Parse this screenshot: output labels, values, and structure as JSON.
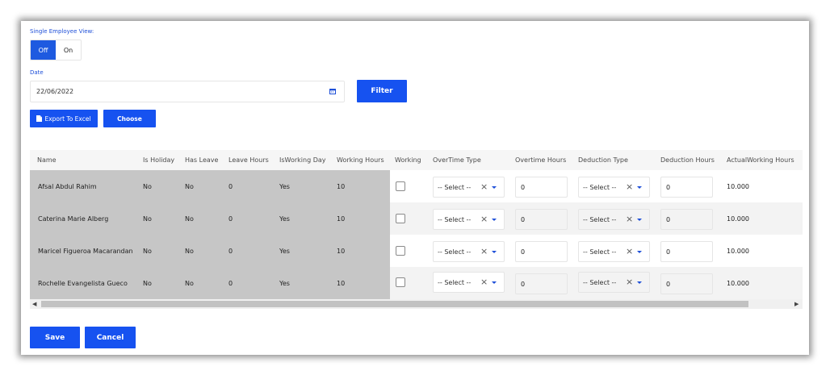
{
  "single_view": {
    "label": "Single Employee View:",
    "off": "Off",
    "on": "On"
  },
  "date": {
    "label": "Date",
    "value": "22/06/2022"
  },
  "buttons": {
    "filter": "Filter",
    "export": "Export To Excel",
    "choose": "Choose",
    "save": "Save",
    "cancel": "Cancel"
  },
  "headers": [
    "Name",
    "Is Holiday",
    "Has Leave",
    "Leave Hours",
    "IsWorking Day",
    "Working Hours",
    "Working",
    "OverTime Type",
    "Overtime Hours",
    "Deduction Type",
    "Deduction Hours",
    "ActualWorking Hours"
  ],
  "rows": [
    {
      "name": "Afsal Abdul Rahim",
      "holiday": "No",
      "leave": "No",
      "leave_hours": "0",
      "working_day": "Yes",
      "working_hours": "10",
      "ot_type": "-- Select --",
      "ot_hours": "0",
      "ded_type": "-- Select --",
      "ded_hours": "0",
      "actual": "10.000"
    },
    {
      "name": "Caterina Marie Alberg",
      "holiday": "No",
      "leave": "No",
      "leave_hours": "0",
      "working_day": "Yes",
      "working_hours": "10",
      "ot_type": "-- Select --",
      "ot_hours": "0",
      "ded_type": "-- Select --",
      "ded_hours": "0",
      "actual": "10.000"
    },
    {
      "name": "Maricel Figueroa Macarandan",
      "holiday": "No",
      "leave": "No",
      "leave_hours": "0",
      "working_day": "Yes",
      "working_hours": "10",
      "ot_type": "-- Select --",
      "ot_hours": "0",
      "ded_type": "-- Select --",
      "ded_hours": "0",
      "actual": "10.000"
    },
    {
      "name": "Rochelle Evangelista Gueco",
      "holiday": "No",
      "leave": "No",
      "leave_hours": "0",
      "working_day": "Yes",
      "working_hours": "10",
      "ot_type": "-- Select --",
      "ot_hours": "0",
      "ded_type": "-- Select --",
      "ded_hours": "0",
      "actual": "10.000"
    }
  ],
  "colors": {
    "accent": "#1652f0",
    "frozen_bg": "#c6c6c6"
  },
  "icons": {
    "calendar": "calendar-icon",
    "document": "document-icon",
    "clear": "clear-icon",
    "caret": "caret-down-icon"
  }
}
